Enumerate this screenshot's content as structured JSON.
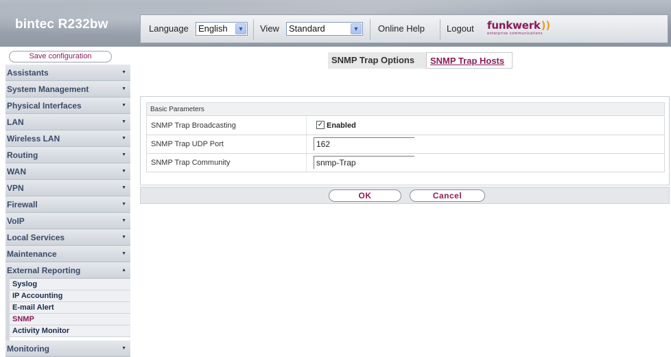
{
  "header": {
    "brand": "bintec R232bw",
    "language_label": "Language",
    "language_value": "English",
    "view_label": "View",
    "view_value": "Standard",
    "online_help": "Online Help",
    "logout": "Logout",
    "logo_text": "funkwerk",
    "logo_waves": "))",
    "logo_sub": "enterprise communications"
  },
  "sidebar": {
    "save_configuration": "Save configuration",
    "items": [
      {
        "label": "Assistants"
      },
      {
        "label": "System Management"
      },
      {
        "label": "Physical Interfaces"
      },
      {
        "label": "LAN"
      },
      {
        "label": "Wireless LAN"
      },
      {
        "label": "Routing"
      },
      {
        "label": "WAN"
      },
      {
        "label": "VPN"
      },
      {
        "label": "Firewall"
      },
      {
        "label": "VoIP"
      },
      {
        "label": "Local Services"
      },
      {
        "label": "Maintenance"
      },
      {
        "label": "External Reporting"
      }
    ],
    "subitems": [
      {
        "label": "Syslog"
      },
      {
        "label": "IP Accounting"
      },
      {
        "label": "E-mail Alert"
      },
      {
        "label": "SNMP",
        "active": true
      },
      {
        "label": "Activity Monitor"
      }
    ],
    "last_item": {
      "label": "Monitoring"
    }
  },
  "tabs": [
    {
      "label": "SNMP Trap Options",
      "active": true
    },
    {
      "label": "SNMP Trap Hosts",
      "active": false
    }
  ],
  "form": {
    "section_title": "Basic Parameters",
    "rows": [
      {
        "label": "SNMP Trap Broadcasting",
        "type": "checkbox",
        "checked": true,
        "value": "Enabled"
      },
      {
        "label": "SNMP Trap UDP Port",
        "type": "text",
        "value": "162"
      },
      {
        "label": "SNMP Trap Community",
        "type": "text",
        "value": "snmp-Trap"
      }
    ]
  },
  "buttons": {
    "ok": "OK",
    "cancel": "Cancel"
  },
  "colors": {
    "accent": "#8a1c5a",
    "nav_text": "#3a4a6a",
    "header_bg": "#9ea6b1"
  },
  "icons": {
    "dropdown": "chevron-down-icon",
    "nav_collapsed": "caret-down-icon",
    "nav_expanded": "caret-up-icon",
    "check": "checkmark-icon"
  }
}
